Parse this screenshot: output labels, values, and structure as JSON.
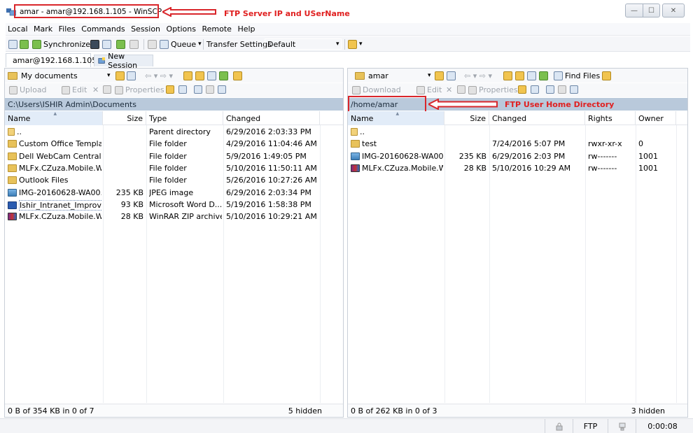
{
  "window": {
    "title": "amar - amar@192.168.1.105 - WinSCP",
    "min_symbol": "—",
    "max_symbol": "☐",
    "close_symbol": "✕"
  },
  "annotations": {
    "server_label": "FTP Server IP and USerName",
    "home_label": "FTP User Home Directory",
    "color": "#d9262b"
  },
  "menu": [
    "Local",
    "Mark",
    "Files",
    "Commands",
    "Session",
    "Options",
    "Remote",
    "Help"
  ],
  "toolbar": {
    "synchronize": "Synchronize",
    "queue": "Queue",
    "queue_arrow": "▾",
    "transfer_settings_label": "Transfer Settings",
    "transfer_settings_value": "Default",
    "dropdown_arrow": "▾"
  },
  "tabs": {
    "session": "amar@192.168.1.105",
    "new_session": "New Session"
  },
  "left_panel": {
    "location": "My documents",
    "actions": {
      "upload": "Upload",
      "edit": "Edit",
      "properties": "Properties"
    },
    "path": "C:\\Users\\ISHIR Admin\\Documents",
    "columns": [
      "Name",
      "Size",
      "Type",
      "Changed"
    ],
    "files": [
      {
        "name": "..",
        "size": "",
        "type": "Parent directory",
        "changed": "6/29/2016 2:03:33 PM",
        "icon": "parent"
      },
      {
        "name": "Custom Office Templa...",
        "size": "",
        "type": "File folder",
        "changed": "4/29/2016 11:04:46 AM",
        "icon": "folder"
      },
      {
        "name": "Dell WebCam Central",
        "size": "",
        "type": "File folder",
        "changed": "5/9/2016 1:49:05 PM",
        "icon": "folder"
      },
      {
        "name": "MLFx.CZuza.Mobile.W...",
        "size": "",
        "type": "File folder",
        "changed": "5/10/2016 11:50:11 AM",
        "icon": "folder"
      },
      {
        "name": "Outlook Files",
        "size": "",
        "type": "File folder",
        "changed": "5/26/2016 10:27:26 AM",
        "icon": "folder"
      },
      {
        "name": "IMG-20160628-WA00...",
        "size": "235 KB",
        "type": "JPEG image",
        "changed": "6/29/2016 2:03:34 PM",
        "icon": "image"
      },
      {
        "name": "Ishir_Intranet_Improve...",
        "size": "93 KB",
        "type": "Microsoft Word D...",
        "changed": "5/19/2016 1:58:38 PM",
        "icon": "word"
      },
      {
        "name": "MLFx.CZuza.Mobile.W...",
        "size": "28 KB",
        "type": "WinRAR ZIP archive",
        "changed": "5/10/2016 10:29:21 AM",
        "icon": "rar"
      }
    ],
    "status_left": "0 B of 354 KB in 0 of 7",
    "status_right": "5 hidden"
  },
  "right_panel": {
    "location": "amar",
    "find_files": "Find Files",
    "actions": {
      "download": "Download",
      "edit": "Edit",
      "properties": "Properties"
    },
    "path": "/home/amar",
    "columns": [
      "Name",
      "Size",
      "Changed",
      "Rights",
      "Owner"
    ],
    "files": [
      {
        "name": "..",
        "size": "",
        "changed": "",
        "rights": "",
        "owner": "",
        "icon": "parent"
      },
      {
        "name": "test",
        "size": "",
        "changed": "7/24/2016 5:07 PM",
        "rights": "rwxr-xr-x",
        "owner": "0",
        "icon": "folder"
      },
      {
        "name": "IMG-20160628-WA00...",
        "size": "235 KB",
        "changed": "6/29/2016 2:03 PM",
        "rights": "rw-------",
        "owner": "1001",
        "icon": "image"
      },
      {
        "name": "MLFx.CZuza.Mobile.W...",
        "size": "28 KB",
        "changed": "5/10/2016 10:29 AM",
        "rights": "rw-------",
        "owner": "1001",
        "icon": "rar"
      }
    ],
    "status_left": "0 B of 262 KB in 0 of 3",
    "status_right": "3 hidden"
  },
  "bottom_status": {
    "protocol": "FTP",
    "elapsed": "0:00:08"
  }
}
